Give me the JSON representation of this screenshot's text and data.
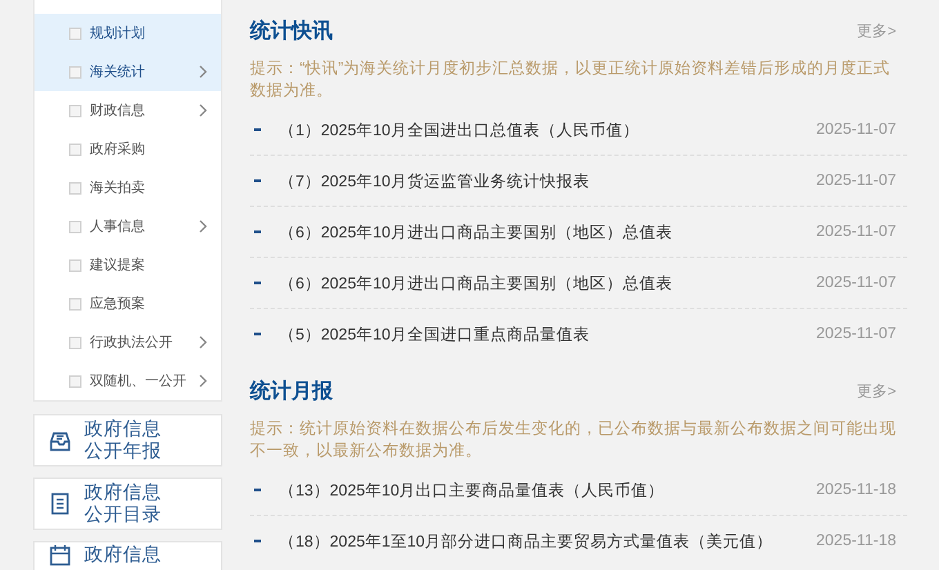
{
  "sidebar": {
    "items": [
      {
        "label": "规划计划",
        "selected": true,
        "has_submenu": false
      },
      {
        "label": "海关统计",
        "selected": true,
        "has_submenu": true
      },
      {
        "label": "财政信息",
        "selected": false,
        "has_submenu": true
      },
      {
        "label": "政府采购",
        "selected": false,
        "has_submenu": false
      },
      {
        "label": "海关拍卖",
        "selected": false,
        "has_submenu": false
      },
      {
        "label": "人事信息",
        "selected": false,
        "has_submenu": true
      },
      {
        "label": "建议提案",
        "selected": false,
        "has_submenu": false
      },
      {
        "label": "应急预案",
        "selected": false,
        "has_submenu": false
      },
      {
        "label": "行政执法公开",
        "selected": false,
        "has_submenu": true
      },
      {
        "label": "双随机、一公开",
        "selected": false,
        "has_submenu": true
      }
    ]
  },
  "cards": [
    {
      "kind": "tray",
      "lines": [
        "政府信息",
        "公开年报"
      ]
    },
    {
      "kind": "list",
      "lines": [
        "政府信息",
        "公开目录"
      ]
    },
    {
      "kind": "calendar",
      "lines": [
        "政府信息"
      ]
    }
  ],
  "sections": [
    {
      "title": "统计快讯",
      "more": "更多>",
      "notice": "提示：“快讯”为海关统计月度初步汇总数据，以更正统计原始资料差错后形成的月度正式数据为准。",
      "items": [
        {
          "title": "（1）2025年10月全国进出口总值表（人民币值）",
          "date": "2025-11-07"
        },
        {
          "title": "（7）2025年10月货运监管业务统计快报表",
          "date": "2025-11-07"
        },
        {
          "title": "（6）2025年10月进出口商品主要国别（地区）总值表",
          "date": "2025-11-07"
        },
        {
          "title": "（6）2025年10月进出口商品主要国别（地区）总值表",
          "date": "2025-11-07"
        },
        {
          "title": "（5）2025年10月全国进口重点商品量值表",
          "date": "2025-11-07"
        }
      ]
    },
    {
      "title": "统计月报",
      "more": "更多>",
      "notice": "提示：统计原始资料在数据公布后发生变化的，已公布数据与最新公布数据之间可能出现不一致，以最新公布数据为准。",
      "items": [
        {
          "title": "（13）2025年10月出口主要商品量值表（人民币值）",
          "date": "2025-11-18"
        },
        {
          "title": "（18）2025年1至10月部分进口商品主要贸易方式量值表（美元值）",
          "date": "2025-11-18"
        }
      ]
    }
  ]
}
